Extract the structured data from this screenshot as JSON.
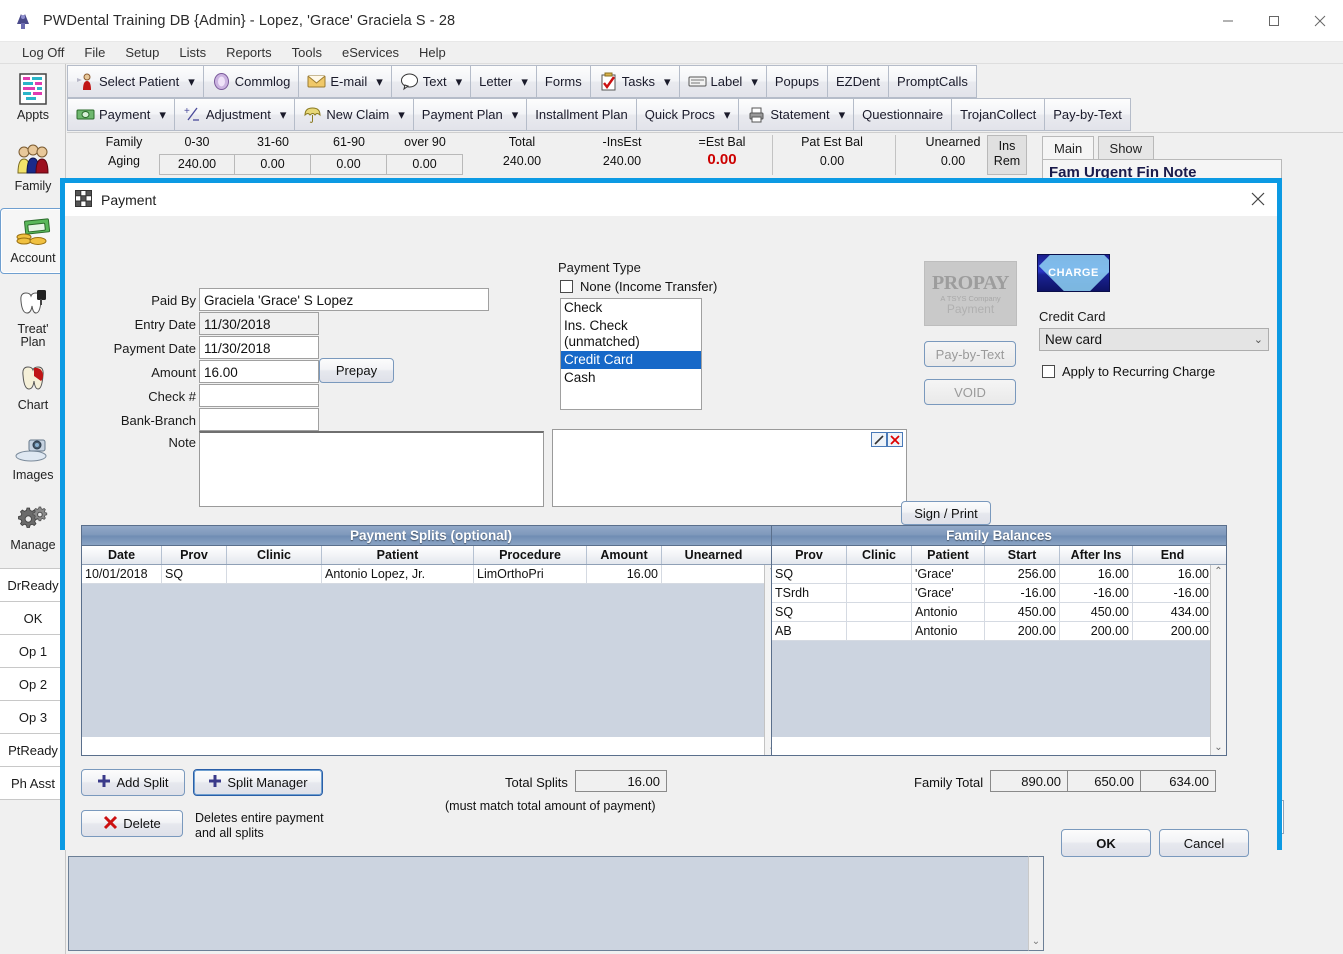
{
  "window": {
    "title": "PWDental Training DB {Admin} - Lopez, 'Grace' Graciela S - 28",
    "app_icon": "dental-app-icon",
    "minimize": "minimize-icon",
    "maximize": "maximize-icon",
    "close": "close-icon"
  },
  "menubar": {
    "items": [
      {
        "label": "Log Off"
      },
      {
        "label": "File"
      },
      {
        "label": "Setup"
      },
      {
        "label": "Lists"
      },
      {
        "label": "Reports"
      },
      {
        "label": "Tools"
      },
      {
        "label": "eServices"
      },
      {
        "label": "Help"
      }
    ]
  },
  "sidebar": {
    "modules": [
      {
        "label": "Appts",
        "icon": "calendar-icon",
        "selected": false
      },
      {
        "label": "Family",
        "icon": "people-icon",
        "selected": false
      },
      {
        "label": "Account",
        "icon": "money-icon",
        "selected": true
      },
      {
        "label": "Treat' Plan",
        "icon": "treatment-plan-icon",
        "selected": false
      },
      {
        "label": "Chart",
        "icon": "tooth-chart-icon",
        "selected": false
      },
      {
        "label": "Images",
        "icon": "scanner-icon",
        "selected": false
      },
      {
        "label": "Manage",
        "icon": "gears-icon",
        "selected": false
      }
    ],
    "status_buttons": [
      {
        "label": "DrReady"
      },
      {
        "label": "OK"
      },
      {
        "label": "Op 1"
      },
      {
        "label": "Op 2"
      },
      {
        "label": "Op 3"
      },
      {
        "label": "PtReady"
      },
      {
        "label": "Ph Asst"
      }
    ]
  },
  "toolbar_row1": [
    {
      "label": "Select Patient",
      "icon": "patient-icon",
      "dropdown": true
    },
    {
      "label": "Commlog",
      "icon": "commlog-icon",
      "dropdown": false
    },
    {
      "label": "E-mail",
      "icon": "email-icon",
      "dropdown": true
    },
    {
      "label": "Text",
      "icon": "text-bubble-icon",
      "dropdown": true
    },
    {
      "label": "Letter",
      "icon": "",
      "dropdown": true
    },
    {
      "label": "Forms",
      "icon": "",
      "dropdown": false
    },
    {
      "label": "Tasks",
      "icon": "tasks-icon",
      "dropdown": true
    },
    {
      "label": "Label",
      "icon": "label-icon",
      "dropdown": true
    },
    {
      "label": "Popups",
      "icon": "",
      "dropdown": false
    },
    {
      "label": "EZDent",
      "icon": "",
      "dropdown": false
    },
    {
      "label": "PromptCalls",
      "icon": "",
      "dropdown": false
    }
  ],
  "toolbar_row2": [
    {
      "label": "Payment",
      "icon": "cash-icon",
      "dropdown": true
    },
    {
      "label": "Adjustment",
      "icon": "plusminus-icon",
      "dropdown": true
    },
    {
      "label": "New Claim",
      "icon": "umbrella-icon",
      "dropdown": true
    },
    {
      "label": "Payment Plan",
      "icon": "",
      "dropdown": true
    },
    {
      "label": "Installment Plan",
      "icon": "",
      "dropdown": false
    },
    {
      "label": "Quick Procs",
      "icon": "",
      "dropdown": true
    },
    {
      "label": "Statement",
      "icon": "printer-icon",
      "dropdown": true
    },
    {
      "label": "Questionnaire",
      "icon": "",
      "dropdown": false
    },
    {
      "label": "TrojanCollect",
      "icon": "",
      "dropdown": false
    },
    {
      "label": "Pay-by-Text",
      "icon": "",
      "dropdown": false
    }
  ],
  "aging": {
    "row_label_1": "Family",
    "row_label_2": "Aging",
    "columns": [
      {
        "header": "0-30",
        "value": "240.00"
      },
      {
        "header": "31-60",
        "value": "0.00"
      },
      {
        "header": "61-90",
        "value": "0.00"
      },
      {
        "header": "over 90",
        "value": "0.00"
      }
    ],
    "total_header": "Total",
    "total_value": "240.00",
    "insest_header": "-InsEst",
    "insest_value": "240.00",
    "estbal_header": "=Est Bal",
    "estbal_value": "0.00",
    "estbal_color": "#cc0000",
    "patestbal_header": "Pat Est Bal",
    "patestbal_value": "0.00",
    "unearned_header": "Unearned",
    "unearned_value": "0.00",
    "insrem_line1": "Ins",
    "insrem_line2": "Rem"
  },
  "background_tabs": {
    "tabs": [
      {
        "label": "Main",
        "active": true
      },
      {
        "label": "Show",
        "active": false
      }
    ],
    "panel_title": "Fam Urgent Fin Note"
  },
  "dialog": {
    "title": "Payment",
    "icon": "payment-grid-icon",
    "close_icon": "close-icon",
    "fields": {
      "paid_by_label": "Paid By",
      "paid_by_value": "Graciela 'Grace' S Lopez",
      "entry_date_label": "Entry Date",
      "entry_date_value": "11/30/2018",
      "payment_date_label": "Payment Date",
      "payment_date_value": "11/30/2018",
      "amount_label": "Amount",
      "amount_value": "16.00",
      "check_label": "Check #",
      "check_value": "",
      "bank_branch_label": "Bank-Branch",
      "bank_branch_value": "",
      "note_label": "Note",
      "note_value": "",
      "prepay_button": "Prepay"
    },
    "payment_type": {
      "label": "Payment Type",
      "none_checkbox_label": "None (Income Transfer)",
      "none_checked": false,
      "options": [
        {
          "label": "Check",
          "selected": false
        },
        {
          "label": "Ins. Check (unmatched)",
          "selected": false
        },
        {
          "label": "Credit Card",
          "selected": true
        },
        {
          "label": "Cash",
          "selected": false
        }
      ]
    },
    "processing": {
      "propay_line1": "PROPAY",
      "propay_line2": "A TSYS Company",
      "propay_line3": "Payment",
      "pay_by_text_button": "Pay-by-Text",
      "void_button": "VOID",
      "xcharge_logo": "CHARGE",
      "credit_card_label": "Credit Card",
      "credit_card_value": "New card",
      "recurring_label": "Apply to Recurring Charge",
      "recurring_checked": false
    },
    "signature": {
      "sign_print_button": "Sign / Print",
      "edit_icon": "pencil-icon",
      "clear_icon": "red-x-icon"
    },
    "splits_grid": {
      "caption": "Payment Splits (optional)",
      "headers": [
        "Date",
        "Prov",
        "Clinic",
        "Patient",
        "Procedure",
        "Amount",
        "Unearned"
      ],
      "rows": [
        {
          "date": "10/01/2018",
          "prov": "SQ",
          "clinic": "",
          "patient": "Antonio Lopez, Jr.",
          "procedure": "LimOrthoPri",
          "amount": "16.00",
          "unearned": ""
        }
      ]
    },
    "family_grid": {
      "caption": "Family Balances",
      "headers": [
        "Prov",
        "Clinic",
        "Patient",
        "Start",
        "After Ins",
        "End"
      ],
      "rows": [
        {
          "prov": "SQ",
          "clinic": "",
          "patient": "'Grace'",
          "start": "256.00",
          "after_ins": "16.00",
          "end": "16.00"
        },
        {
          "prov": "TSrdh",
          "clinic": "",
          "patient": "'Grace'",
          "start": "-16.00",
          "after_ins": "-16.00",
          "end": "-16.00"
        },
        {
          "prov": "SQ",
          "clinic": "",
          "patient": "Antonio",
          "start": "450.00",
          "after_ins": "450.00",
          "end": "434.00"
        },
        {
          "prov": "AB",
          "clinic": "",
          "patient": "Antonio",
          "start": "200.00",
          "after_ins": "200.00",
          "end": "200.00"
        }
      ]
    },
    "buttons": {
      "add_split": "Add Split",
      "split_manager": "Split Manager",
      "delete": "Delete",
      "delete_hint_line1": "Deletes entire payment",
      "delete_hint_line2": "and all splits",
      "ok": "OK",
      "cancel": "Cancel"
    },
    "totals": {
      "total_splits_label": "Total Splits",
      "total_splits_value": "16.00",
      "must_match_note": "(must match total amount of payment)",
      "family_total_label": "Family Total",
      "family_total_start": "890.00",
      "family_total_after_ins": "650.00",
      "family_total_end": "634.00"
    }
  },
  "colors": {
    "dialog_border": "#0c9ae3",
    "grid_caption": "#7d97ba",
    "selection_blue": "#1668c8",
    "alert_red": "#cc0000"
  }
}
